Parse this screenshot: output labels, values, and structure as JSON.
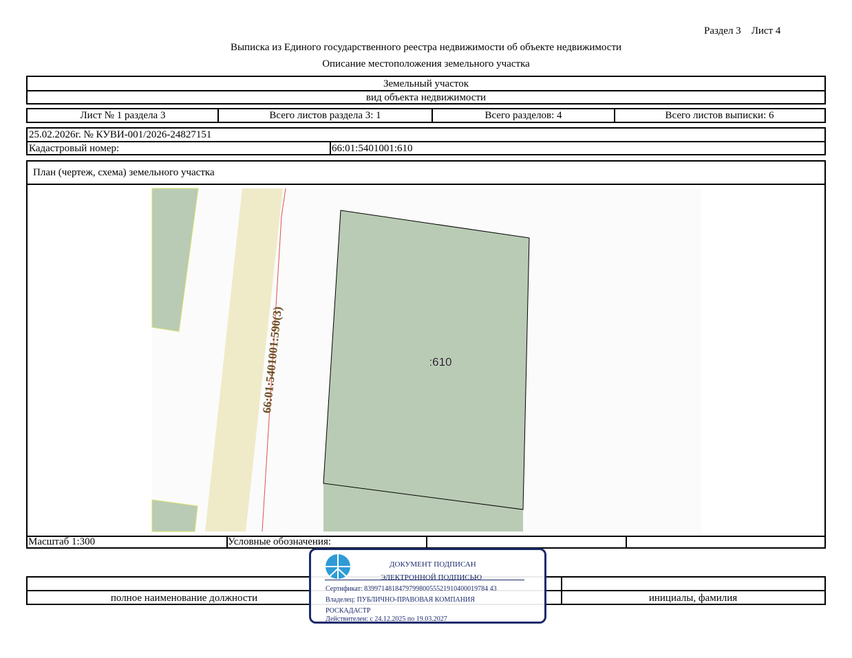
{
  "page_ref": {
    "section": "Раздел 3",
    "sheet": "Лист 4"
  },
  "title": "Выписка из Единого государственного реестра недвижимости об объекте недвижимости",
  "subtitle": "Описание местоположения земельного участка",
  "object": {
    "type": "Земельный участок",
    "caption": "вид объекта недвижимости"
  },
  "sheet_info": {
    "sheet": "Лист № 1 раздела 3",
    "total_section_sheets": "Всего листов раздела 3: 1",
    "total_sections": "Всего разделов: 4",
    "total_extract_sheets": "Всего листов выписки: 6"
  },
  "doc_number": "25.02.2026г. № КУВИ-001/2026-24827151",
  "cadastral": {
    "label": "Кадастровый номер:",
    "value": "66:01:5401001:610"
  },
  "plan": {
    "title": "План (чертеж, схема) земельного участка",
    "parcel_label": ":610",
    "neighbor_label": "66:01:5401001:590(3)"
  },
  "scale": "Масштаб 1:300",
  "legend_label": "Условные обозначения:",
  "signature": {
    "position_caption": "полное наименование должности",
    "name_caption": "инициалы, фамилия"
  },
  "stamp": {
    "line1": "ДОКУМЕНТ ПОДПИСАН",
    "line2": "ЭЛЕКТРОННОЙ ПОДПИСЬЮ",
    "certificate": "Сертификат: 839971481847979980055521910400019784 43",
    "owner": "Владелец: ПУБЛИЧНО-ПРАВОВАЯ КОМПАНИЯ",
    "owner2": "РОСКАДАСТР",
    "validity": "Действителен: с 24.12.2025 по 19.03.2027"
  },
  "colors": {
    "parcel_fill": "#b9cbb4",
    "road_fill": "#efebc8",
    "stamp": "#1b2a6b",
    "boundary_red": "#e05050"
  },
  "icons": [
    "rosreestr-logo-icon"
  ]
}
